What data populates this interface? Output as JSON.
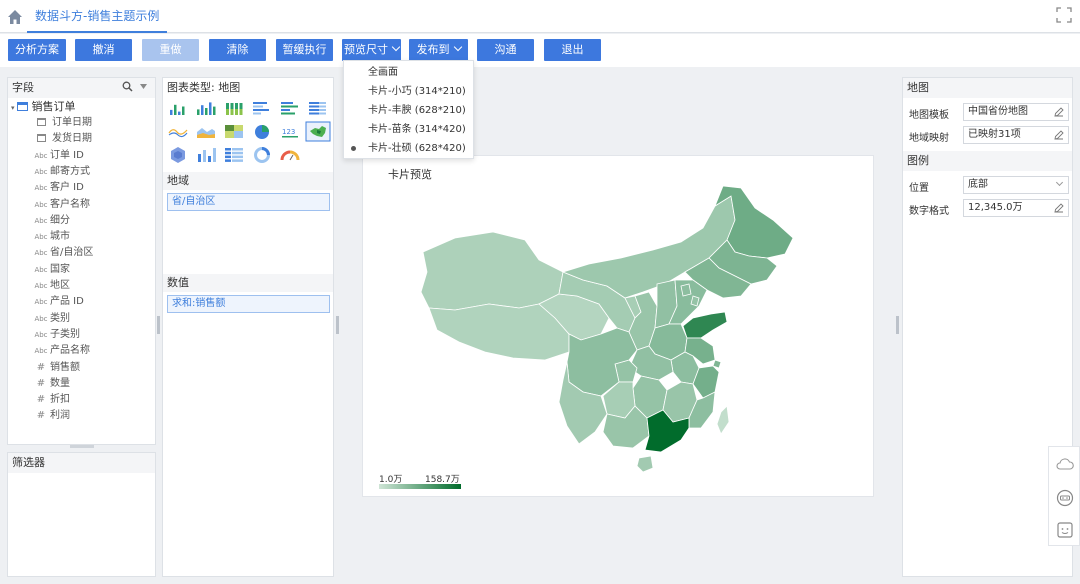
{
  "tab": {
    "title": "数据斗方-销售主题示例"
  },
  "toolbar": {
    "analysis": "分析方案",
    "undo": "撤消",
    "redo": "重做",
    "clear": "清除",
    "pause": "暂缓执行",
    "preview_size": "预览尺寸",
    "publish": "发布到",
    "link": "沟通",
    "exit": "退出"
  },
  "preview_menu": {
    "items": [
      "全画面",
      "卡片-小巧 (314*210)",
      "卡片-丰腴 (628*210)",
      "卡片-苗条 (314*420)",
      "卡片-壮硕 (628*420)"
    ],
    "selected_index": 4
  },
  "fields": {
    "title": "字段",
    "root": "销售订单",
    "items": [
      {
        "type": "date",
        "label": "订单日期"
      },
      {
        "type": "date",
        "label": "发货日期"
      },
      {
        "type": "text",
        "label": "订单 ID"
      },
      {
        "type": "text",
        "label": "邮寄方式"
      },
      {
        "type": "text",
        "label": "客户 ID"
      },
      {
        "type": "text",
        "label": "客户名称"
      },
      {
        "type": "text",
        "label": "细分"
      },
      {
        "type": "text",
        "label": "城市"
      },
      {
        "type": "text",
        "label": "省/自治区"
      },
      {
        "type": "text",
        "label": "国家"
      },
      {
        "type": "text",
        "label": "地区"
      },
      {
        "type": "text",
        "label": "产品 ID"
      },
      {
        "type": "text",
        "label": "类别"
      },
      {
        "type": "text",
        "label": "子类别"
      },
      {
        "type": "text",
        "label": "产品名称"
      },
      {
        "type": "num",
        "label": "销售额"
      },
      {
        "type": "num",
        "label": "数量"
      },
      {
        "type": "num",
        "label": "折扣"
      },
      {
        "type": "num",
        "label": "利润"
      }
    ],
    "text_badge": "Abc",
    "num_badge": "#"
  },
  "filter": {
    "title": "筛选器"
  },
  "chart_config": {
    "type_label": "图表类型: 地图",
    "region_title": "地域",
    "region_value": "省/自治区",
    "value_title": "数值",
    "value_field": "求和:销售额",
    "icon_label_123": "123"
  },
  "preview": {
    "title": "卡片预览",
    "legend_min": "1.0万",
    "legend_max": "158.7万",
    "colors": {
      "low": "#cfe5d6",
      "high": "#006b2b"
    }
  },
  "right_panel": {
    "map_section": "地图",
    "map_template_label": "地图模板",
    "map_template_value": "中国省份地图",
    "map_mapping_label": "地域映射",
    "map_mapping_value": "已映射31项",
    "legend_section": "图例",
    "position_label": "位置",
    "position_value": "底部",
    "numfmt_label": "数字格式",
    "numfmt_value": "12,345.0万"
  },
  "colors": {
    "accent": "#3d78de",
    "accent_disabled": "#a9c4ee"
  }
}
